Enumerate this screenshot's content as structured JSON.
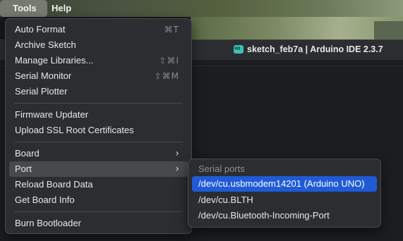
{
  "menubar": {
    "tools": "Tools",
    "help": "Help"
  },
  "window": {
    "title": "sketch_feb7a | Arduino IDE 2.3.7",
    "icon": "arduino-infinity-icon"
  },
  "tools_menu": {
    "items": [
      {
        "label": "Auto Format",
        "shortcut": "⌘T"
      },
      {
        "label": "Archive Sketch",
        "shortcut": ""
      },
      {
        "label": "Manage Libraries...",
        "shortcut": "⇧⌘I"
      },
      {
        "label": "Serial Monitor",
        "shortcut": "⇧⌘M"
      },
      {
        "label": "Serial Plotter",
        "shortcut": ""
      },
      {
        "label": "Firmware Updater",
        "shortcut": ""
      },
      {
        "label": "Upload SSL Root Certificates",
        "shortcut": ""
      },
      {
        "label": "Board",
        "submenu": true
      },
      {
        "label": "Port",
        "submenu": true,
        "highlighted": true
      },
      {
        "label": "Reload Board Data",
        "shortcut": ""
      },
      {
        "label": "Get Board Info",
        "shortcut": ""
      },
      {
        "label": "Burn Bootloader",
        "shortcut": ""
      }
    ]
  },
  "port_submenu": {
    "header": "Serial ports",
    "items": [
      {
        "label": "/dev/cu.usbmodem14201 (Arduino UNO)",
        "selected": true
      },
      {
        "label": "/dev/cu.BLTH",
        "selected": false
      },
      {
        "label": "/dev/cu.Bluetooth-Incoming-Port",
        "selected": false
      }
    ]
  },
  "colors": {
    "selection": "#1f5bd6",
    "menu_bg": "#2c2d30",
    "highlight": "#47494d"
  }
}
